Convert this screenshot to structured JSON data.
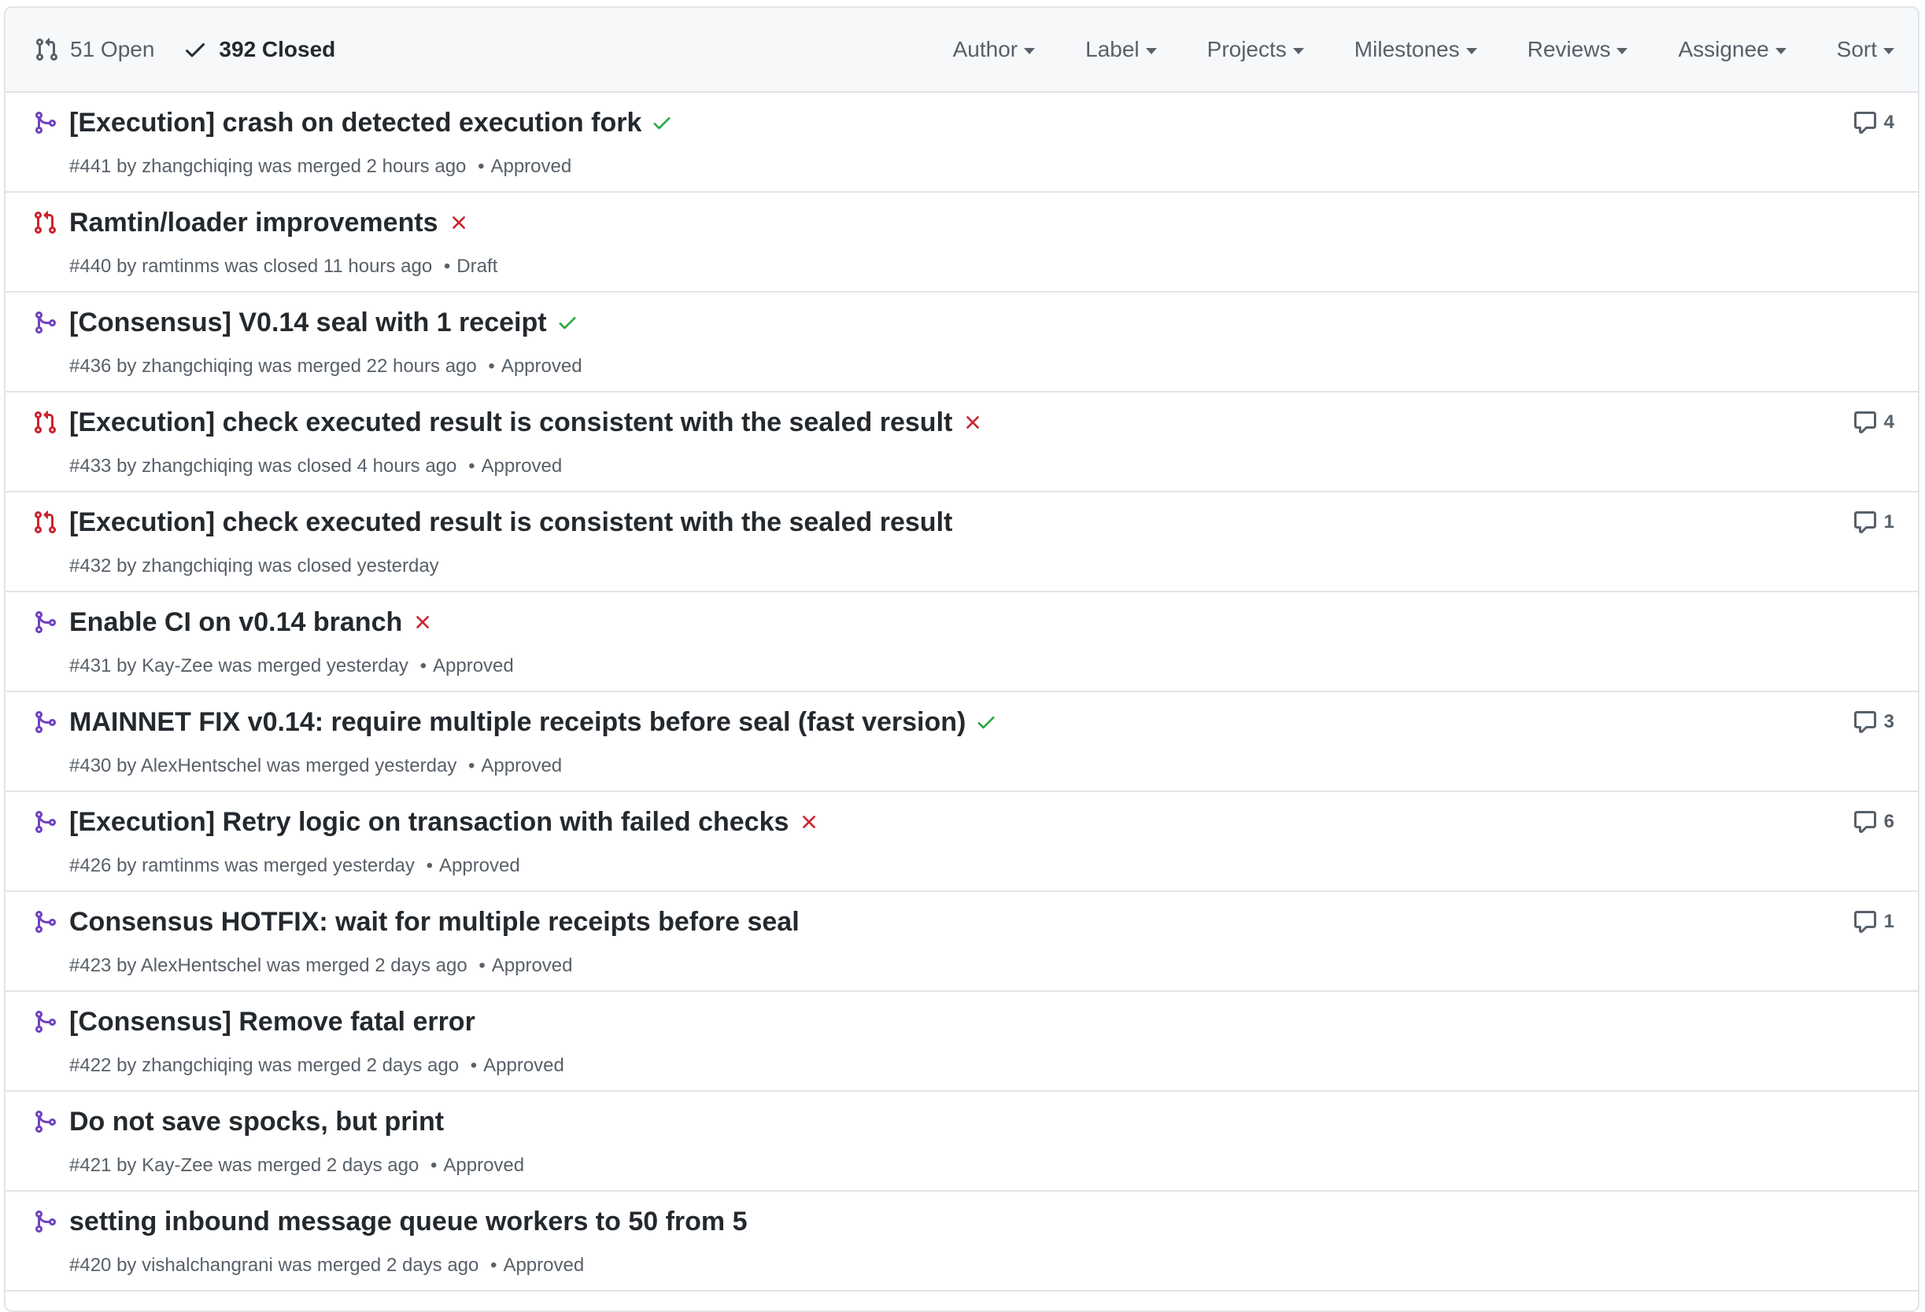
{
  "header": {
    "open_label": "51 Open",
    "closed_label": "392 Closed",
    "filters": [
      "Author",
      "Label",
      "Projects",
      "Milestones",
      "Reviews",
      "Assignee",
      "Sort"
    ]
  },
  "colors": {
    "merged": "#6f42c1",
    "closed": "#cb2431",
    "success": "#28a745",
    "failure": "#cb2431"
  },
  "pulls": [
    {
      "state": "merged",
      "title": "[Execution] crash on detected execution fork",
      "check": "success",
      "number": "#441",
      "author": "zhangchiqing",
      "action": "was merged",
      "time": "2 hours ago",
      "review": "Approved",
      "comments": "4"
    },
    {
      "state": "closed",
      "title": "Ramtin/loader improvements",
      "check": "failure",
      "number": "#440",
      "author": "ramtinms",
      "action": "was closed",
      "time": "11 hours ago",
      "review": "Draft",
      "comments": ""
    },
    {
      "state": "merged",
      "title": "[Consensus] V0.14 seal with 1 receipt",
      "check": "success",
      "number": "#436",
      "author": "zhangchiqing",
      "action": "was merged",
      "time": "22 hours ago",
      "review": "Approved",
      "comments": ""
    },
    {
      "state": "closed",
      "title": "[Execution] check executed result is consistent with the sealed result",
      "check": "failure",
      "number": "#433",
      "author": "zhangchiqing",
      "action": "was closed",
      "time": "4 hours ago",
      "review": "Approved",
      "comments": "4"
    },
    {
      "state": "closed",
      "title": "[Execution] check executed result is consistent with the sealed result",
      "check": "",
      "number": "#432",
      "author": "zhangchiqing",
      "action": "was closed",
      "time": "yesterday",
      "review": "",
      "comments": "1"
    },
    {
      "state": "merged",
      "title": "Enable CI on v0.14 branch",
      "check": "failure",
      "number": "#431",
      "author": "Kay-Zee",
      "action": "was merged",
      "time": "yesterday",
      "review": "Approved",
      "comments": ""
    },
    {
      "state": "merged",
      "title": "MAINNET FIX v0.14: require multiple receipts before seal (fast version)",
      "check": "success",
      "number": "#430",
      "author": "AlexHentschel",
      "action": "was merged",
      "time": "yesterday",
      "review": "Approved",
      "comments": "3"
    },
    {
      "state": "merged",
      "title": "[Execution] Retry logic on transaction with failed checks",
      "check": "failure",
      "number": "#426",
      "author": "ramtinms",
      "action": "was merged",
      "time": "yesterday",
      "review": "Approved",
      "comments": "6"
    },
    {
      "state": "merged",
      "title": "Consensus HOTFIX: wait for multiple receipts before seal",
      "check": "",
      "number": "#423",
      "author": "AlexHentschel",
      "action": "was merged",
      "time": "2 days ago",
      "review": "Approved",
      "comments": "1"
    },
    {
      "state": "merged",
      "title": "[Consensus] Remove fatal error",
      "check": "",
      "number": "#422",
      "author": "zhangchiqing",
      "action": "was merged",
      "time": "2 days ago",
      "review": "Approved",
      "comments": ""
    },
    {
      "state": "merged",
      "title": "Do not save spocks, but print",
      "check": "",
      "number": "#421",
      "author": "Kay-Zee",
      "action": "was merged",
      "time": "2 days ago",
      "review": "Approved",
      "comments": ""
    },
    {
      "state": "merged",
      "title": "setting inbound message queue workers to 50 from 5",
      "check": "",
      "number": "#420",
      "author": "vishalchangrani",
      "action": "was merged",
      "time": "2 days ago",
      "review": "Approved",
      "comments": ""
    }
  ]
}
